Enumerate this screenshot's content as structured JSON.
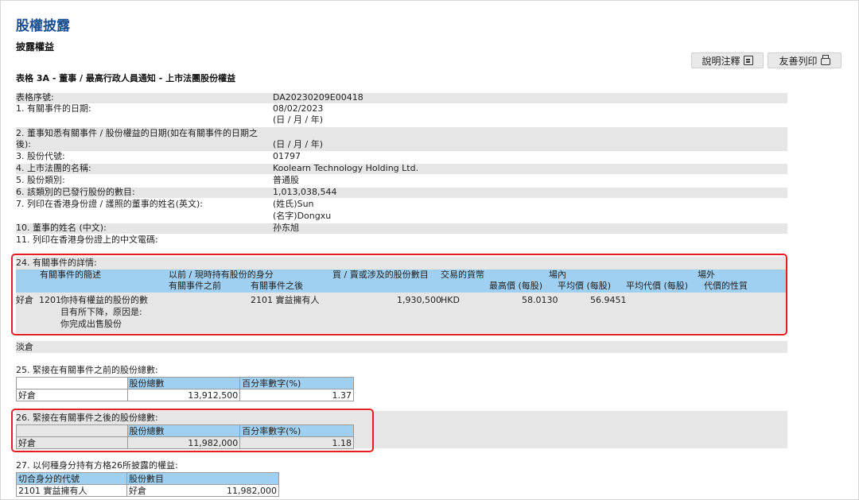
{
  "header": {
    "title": "股權披露",
    "subtitle": "披露權益",
    "form_title": "表格 3A - 董事 / 最高行政人員通知 - 上市法團股份權益",
    "notes_label": "說明注釋",
    "print_label": "友善列印"
  },
  "fields": [
    {
      "label": "表格序號:",
      "value": "DA20230209E00418"
    },
    {
      "label": "1. 有關事件的日期:",
      "value": "08/02/2023",
      "value2": "(日 / 月 / 年)"
    },
    {
      "label": "2. 董事知悉有關事件 / 股份權益的日期(如在有關事件的日期之",
      "label2": "後):",
      "value": "(日 / 月 / 年)"
    },
    {
      "label": "3. 股份代號:",
      "value": "01797"
    },
    {
      "label": "4. 上市法團的名稱:",
      "value": "Koolearn Technology Holding Ltd."
    },
    {
      "label": "5. 股份類別:",
      "value": "普通股"
    },
    {
      "label": "6. 該類別的已發行股份的數目:",
      "value": "1,013,038,544"
    },
    {
      "label": "7. 列印在香港身份證 / 護照的董事的姓名(英文):",
      "value": "(姓氏)Sun",
      "value2": "(名字)Dongxu"
    },
    {
      "label": "10. 董事的姓名 (中文):",
      "value": "孙东旭"
    },
    {
      "label": "11. 列印在香港身份證上的中文電碼:",
      "value": ""
    }
  ],
  "section24": {
    "title": "24. 有關事件的詳情:",
    "headers": {
      "event_desc": "有關事件的簡述",
      "capacity": "以前 / 現時持有股份的身分",
      "before": "有關事件之前",
      "after": "有關事件之後",
      "shares": "買 / 賣或涉及的股份數目",
      "currency": "交易的貨幣",
      "onmarket": "場內",
      "offmarket": "場外",
      "highest": "最高價 (每股)",
      "average": "平均價 (每股)",
      "avg_consideration": "平均代價 (每股)",
      "nature": "代價的性質"
    },
    "row": {
      "position": "好倉",
      "code": "1201",
      "desc_lines": [
        "你持有權益的股份的數",
        "目有所下降，原因是:",
        "你完成出售股份"
      ],
      "after": "2101 實益擁有人",
      "shares": "1,930,500",
      "currency": "HKD",
      "highest": "58.0130",
      "average": "56.9451"
    }
  },
  "short_position": "淡倉",
  "section25": {
    "title": "25. 緊接在有關事件之前的股份總數:",
    "col1": "股份總數",
    "col2": "百分率數字(%)",
    "row_label": "好倉",
    "total": "13,912,500",
    "percent": "1.37"
  },
  "section26": {
    "title": "26. 緊接在有關事件之後的股份總數:",
    "col1": "股份總數",
    "col2": "百分率數字(%)",
    "row_label": "好倉",
    "total": "11,982,000",
    "percent": "1.18"
  },
  "section27": {
    "title": "27. 以何種身分持有方格26所披露的權益:",
    "col1": "切合身分的代號",
    "col2": "股份數目",
    "row_code": "2101 實益擁有人",
    "row_pos": "好倉",
    "row_shares": "11,982,000"
  },
  "colors": {
    "title_blue": "#1b4f93",
    "header_blue": "#9fd0f2",
    "highlight_red": "#e41e25",
    "row_gray": "#e6e6e6"
  }
}
